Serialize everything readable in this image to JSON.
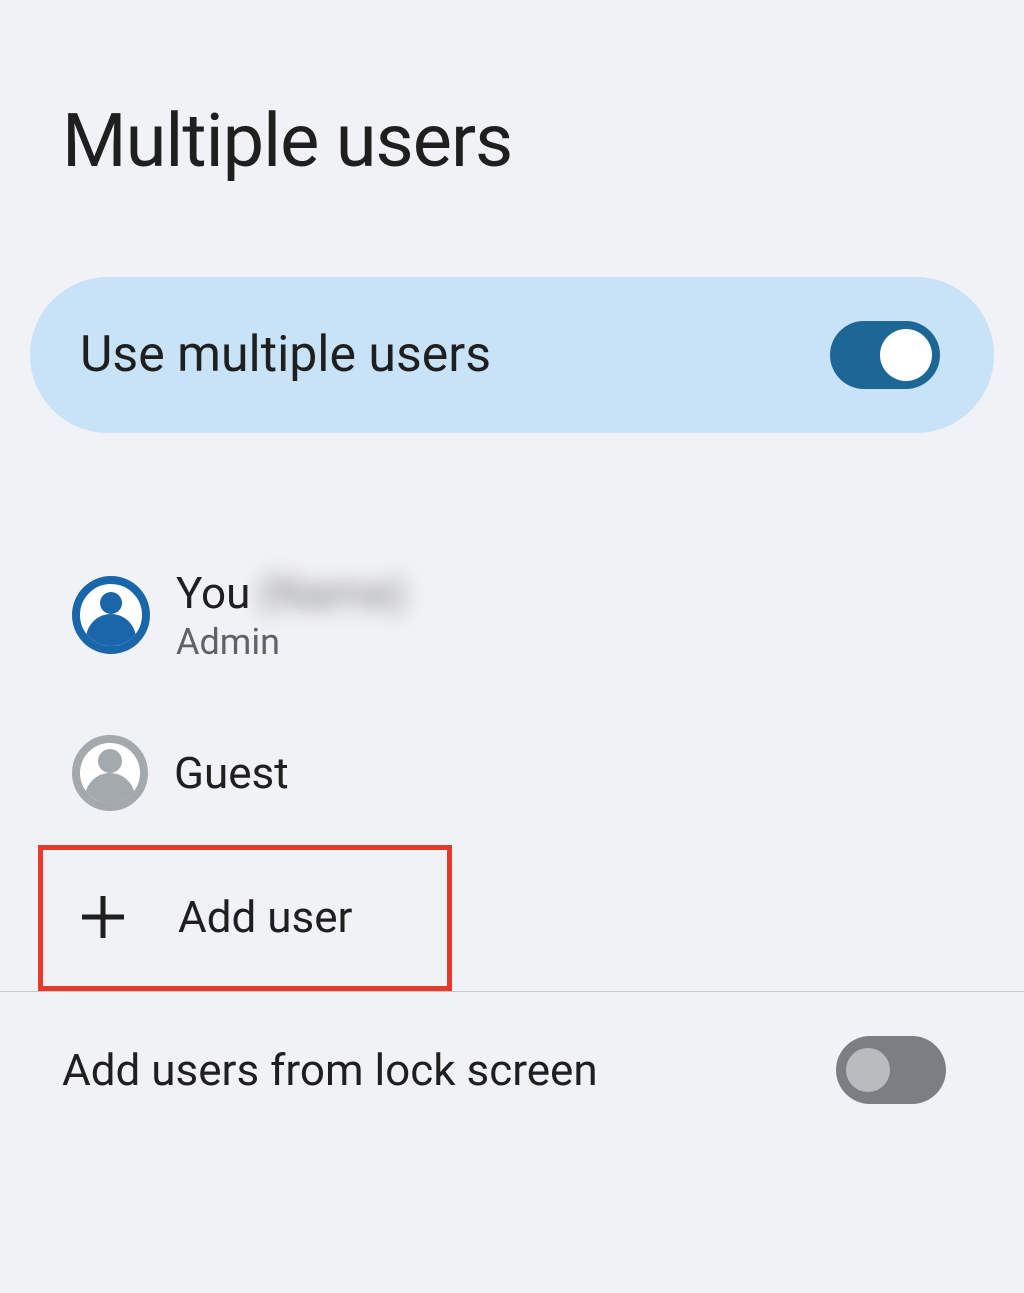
{
  "title": "Multiple users",
  "master_toggle": {
    "label": "Use multiple users",
    "on": true
  },
  "users": [
    {
      "name": "You",
      "name_extra_blurred": "(Name)",
      "subtitle": "Admin",
      "avatar_style": "blue-ring"
    },
    {
      "name": "Guest",
      "subtitle": "",
      "avatar_style": "gray"
    }
  ],
  "add_user": {
    "label": "Add user",
    "highlighted": true
  },
  "lock_screen_toggle": {
    "label": "Add users from lock screen",
    "on": false
  },
  "colors": {
    "accent": "#1d6796",
    "card_bg": "#c8e2f7",
    "highlight_border": "#e83a2a"
  }
}
